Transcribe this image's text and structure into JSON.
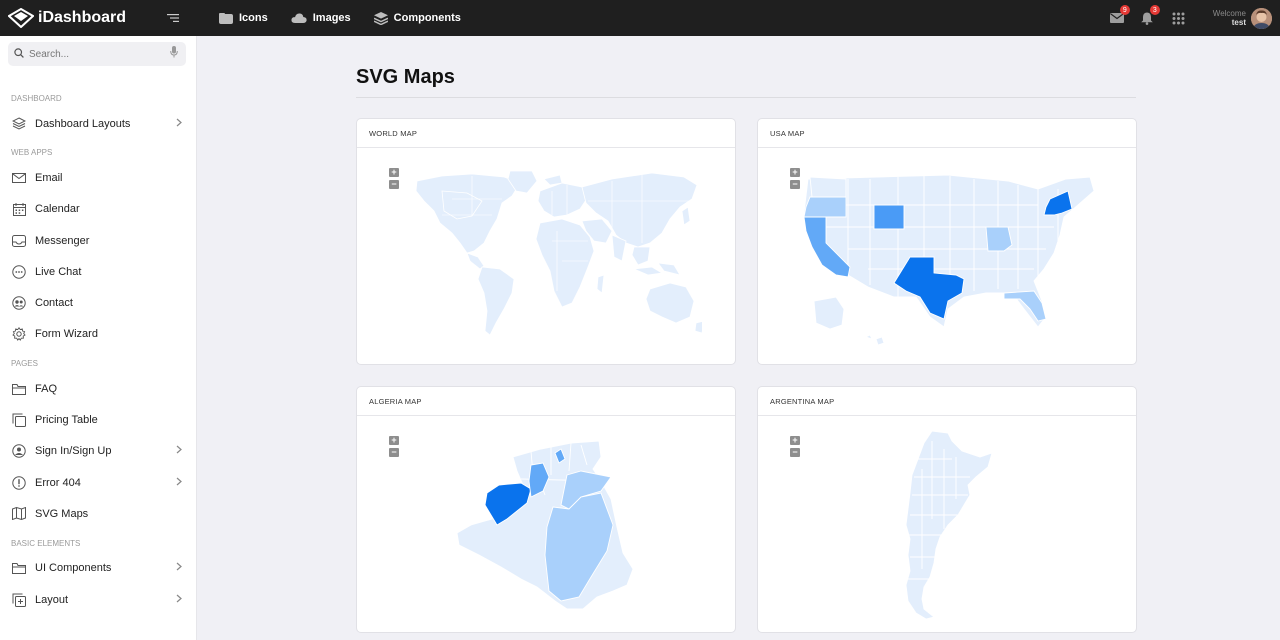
{
  "app": {
    "brand": "iDashboard"
  },
  "topnav": [
    {
      "label": "Icons",
      "icon": "folder-icon"
    },
    {
      "label": "Images",
      "icon": "cloud-icon"
    },
    {
      "label": "Components",
      "icon": "layers-icon"
    }
  ],
  "header": {
    "mail_badge": "9",
    "notification_badge": "3",
    "welcome": "Welcome",
    "user": "test"
  },
  "search": {
    "placeholder": "Search..."
  },
  "sidebar": {
    "sections": {
      "dashboard": "DASHBOARD",
      "webapps": "WEB APPS",
      "pages": "PAGES",
      "basic": "BASIC ELEMENTS"
    },
    "items": {
      "dashboard_layouts": "Dashboard Layouts",
      "email": "Email",
      "calendar": "Calendar",
      "messenger": "Messenger",
      "live_chat": "Live Chat",
      "contact": "Contact",
      "form_wizard": "Form Wizard",
      "faq": "FAQ",
      "pricing_table": "Pricing Table",
      "sign_in": "Sign In/Sign Up",
      "error_404": "Error 404",
      "svg_maps": "SVG Maps",
      "ui_components": "UI Components",
      "layout": "Layout"
    }
  },
  "page": {
    "title": "SVG Maps"
  },
  "cards": {
    "world": "WORLD MAP",
    "usa": "USA MAP",
    "algeria": "ALGERIA MAP",
    "argentina": "ARGENTINA MAP"
  },
  "zoom": {
    "in": "+",
    "out": "−"
  },
  "colors": {
    "map_base": "#e3eefc",
    "map_light": "#a9d0fb",
    "map_mid": "#62a9f7",
    "map_dark": "#0a73ed",
    "topbar": "#1f1f1f"
  }
}
